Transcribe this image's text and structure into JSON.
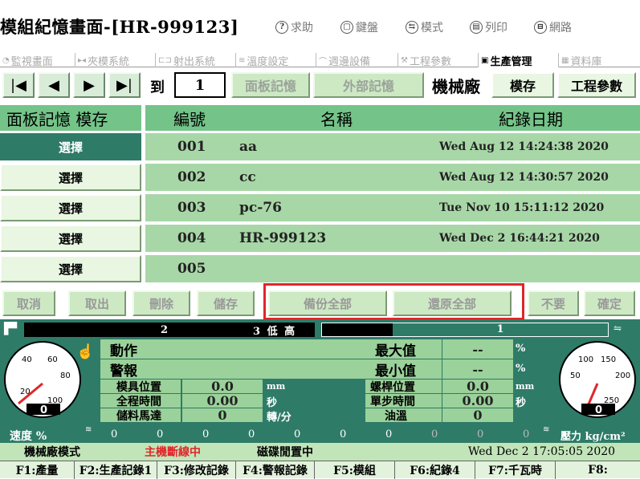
{
  "header": {
    "title": "模組紀憶畫面-[HR-999123]",
    "icons": [
      {
        "label": "求助",
        "glyph": "?"
      },
      {
        "label": "鍵盤",
        "glyph": "▢"
      },
      {
        "label": "模式",
        "glyph": "⇆"
      },
      {
        "label": "列印",
        "glyph": "▤"
      },
      {
        "label": "網路",
        "glyph": "⊟"
      }
    ]
  },
  "tabs": [
    {
      "label": "監視畫面",
      "icon": "eye-icon"
    },
    {
      "label": "夾模系統",
      "icon": "clamp-icon"
    },
    {
      "label": "射出系統",
      "icon": "inject-icon"
    },
    {
      "label": "溫度設定",
      "icon": "temperature-icon"
    },
    {
      "label": "週邊設備",
      "icon": "peripheral-icon"
    },
    {
      "label": "工程參數",
      "icon": "wrench-icon"
    },
    {
      "label": "生產管理",
      "icon": "production-icon"
    },
    {
      "label": "資料庫",
      "icon": "database-icon"
    }
  ],
  "nav": {
    "first": "|◀",
    "prev": "◀",
    "next": "▶",
    "last": "▶|",
    "goto_label": "到",
    "page_value": "1",
    "panel_memory": "面板記憶",
    "external_memory": "外部記憶",
    "factory_label": "機械廠",
    "save": "模存",
    "engineering": "工程參數"
  },
  "table": {
    "headers": [
      "面板記憶 模存",
      "編號",
      "名稱",
      "紀錄日期"
    ],
    "select_label": "選擇",
    "rows": [
      {
        "no": "001",
        "name": "aa",
        "date": "Wed Aug 12 14:24:38 2020"
      },
      {
        "no": "002",
        "name": "cc",
        "date": "Wed Aug 12 14:30:57 2020"
      },
      {
        "no": "003",
        "name": "pc-76",
        "date": "Tue Nov 10 15:11:12 2020"
      },
      {
        "no": "004",
        "name": "HR-999123",
        "date": "Wed Dec  2 16:44:21 2020"
      },
      {
        "no": "005",
        "name": "",
        "date": ""
      }
    ]
  },
  "actions": {
    "cancel": "取消",
    "take_out": "取出",
    "delete": "刪除",
    "store": "儲存",
    "backup_all": "備份全部",
    "restore_all": "還原全部",
    "no": "不要",
    "confirm": "確定"
  },
  "status": {
    "bar_left_num": "2",
    "bar_left_label": "3 低 高",
    "bar_right_num": "1",
    "labels": {
      "action": "動作",
      "alarm": "警報",
      "max": "最大值",
      "min": "最小值",
      "mold_pos": "模具位置",
      "total_time": "全程時間",
      "feed_motor": "儲料馬達",
      "screw_pos": "螺桿位置",
      "step_time": "單步時間",
      "oil_temp": "油溫"
    },
    "values": {
      "max": "--",
      "min": "--",
      "mold_pos": "0.0",
      "total_time": "0.00",
      "feed_motor": "0",
      "screw_pos": "0.0",
      "step_time": "0.00",
      "oil_temp": "0"
    },
    "units": {
      "percent1": "%",
      "percent2": "%",
      "mm1": "mm",
      "mm2": "mm",
      "sec1": "秒",
      "sec2": "秒",
      "rpm": "轉/分"
    },
    "speed_label": "速度 %",
    "pressure_label": "壓力 kg/cm²",
    "speed_gauge": {
      "ticks": [
        "20",
        "40",
        "60",
        "80",
        "100"
      ],
      "value": "0"
    },
    "pressure_gauge": {
      "ticks": [
        "50",
        "100",
        "150",
        "200",
        "250"
      ],
      "value": "0"
    },
    "row_values": [
      "0",
      "0",
      "0",
      "0",
      "0",
      "0",
      "0",
      "0",
      "0",
      "0"
    ]
  },
  "footer": {
    "mode": "機械廠模式",
    "host": "主機斷線中",
    "disk": "磁碟閒置中",
    "datetime": "Wed Dec  2 17:05:05 2020",
    "fkeys": [
      "F1:產量",
      "F2:生產記錄1",
      "F3:修改記錄",
      "F4:警報記錄",
      "F5:模組",
      "F6:紀錄4",
      "F7:千瓦時",
      "F8:"
    ]
  },
  "colors": {
    "accent": "#2e7b68",
    "header_green": "#74c489",
    "row_green": "#a8d7a7",
    "highlight_red": "#e0262a"
  }
}
